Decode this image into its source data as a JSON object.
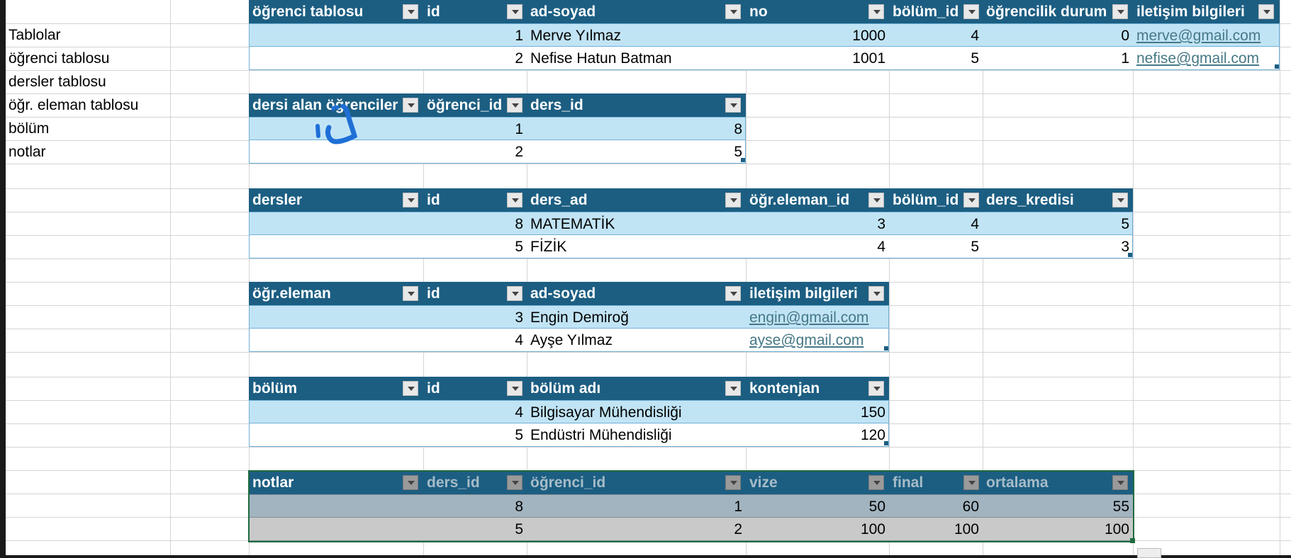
{
  "sidebar": {
    "items": [
      "Tablolar",
      "öğrenci tablosu",
      "dersler tablosu",
      "öğr. eleman tablosu",
      "bölüm",
      "notlar"
    ]
  },
  "ogrenci": {
    "headers": [
      "öğrenci tablosu",
      "id",
      "ad-soyad",
      "no",
      "bölüm_id",
      "öğrencilik durum",
      "iletişim bilgileri"
    ],
    "rows": [
      [
        "",
        "1",
        "Merve Yılmaz",
        "1000",
        "4",
        "0",
        "merve@gmail.com"
      ],
      [
        "",
        "2",
        "Nefise Hatun Batman",
        "1001",
        "5",
        "1",
        "nefise@gmail.com"
      ]
    ]
  },
  "dersi_alan": {
    "headers": [
      "dersi alan öğrenciler",
      "öğrenci_id",
      "ders_id"
    ],
    "rows": [
      [
        "",
        "1",
        "8"
      ],
      [
        "",
        "2",
        "5"
      ]
    ]
  },
  "dersler": {
    "headers": [
      "dersler",
      "id",
      "ders_ad",
      "öğr.eleman_id",
      "bölüm_id",
      "ders_kredisi"
    ],
    "rows": [
      [
        "",
        "8",
        "MATEMATİK",
        "3",
        "4",
        "5"
      ],
      [
        "",
        "5",
        "FİZİK",
        "4",
        "5",
        "3"
      ]
    ]
  },
  "ogr_eleman": {
    "headers": [
      "öğr.eleman",
      "id",
      "ad-soyad",
      "iletişim bilgileri"
    ],
    "rows": [
      [
        "",
        "3",
        "Engin Demiroğ",
        "engin@gmail.com"
      ],
      [
        "",
        "4",
        "Ayşe Yılmaz",
        "ayse@gmail.com"
      ]
    ]
  },
  "bolum": {
    "headers": [
      "bölüm",
      "id",
      "bölüm adı",
      "kontenjan"
    ],
    "rows": [
      [
        "",
        "4",
        "Bilgisayar Mühendisliği",
        "150"
      ],
      [
        "",
        "5",
        "Endüstri Mühendisliği",
        "120"
      ]
    ]
  },
  "notlar": {
    "headers": [
      "notlar",
      "ders_id",
      "öğrenci_id",
      "vize",
      "final",
      "ortalama"
    ],
    "rows": [
      [
        "",
        "8",
        "1",
        "50",
        "60",
        "55"
      ],
      [
        "",
        "5",
        "2",
        "100",
        "100",
        "100"
      ]
    ]
  },
  "colors": {
    "header": "#1c5e82",
    "band": "#c1e4f5",
    "link": "#467886",
    "scribble": "#1f6fd6",
    "selection": "#1e6b3f"
  }
}
